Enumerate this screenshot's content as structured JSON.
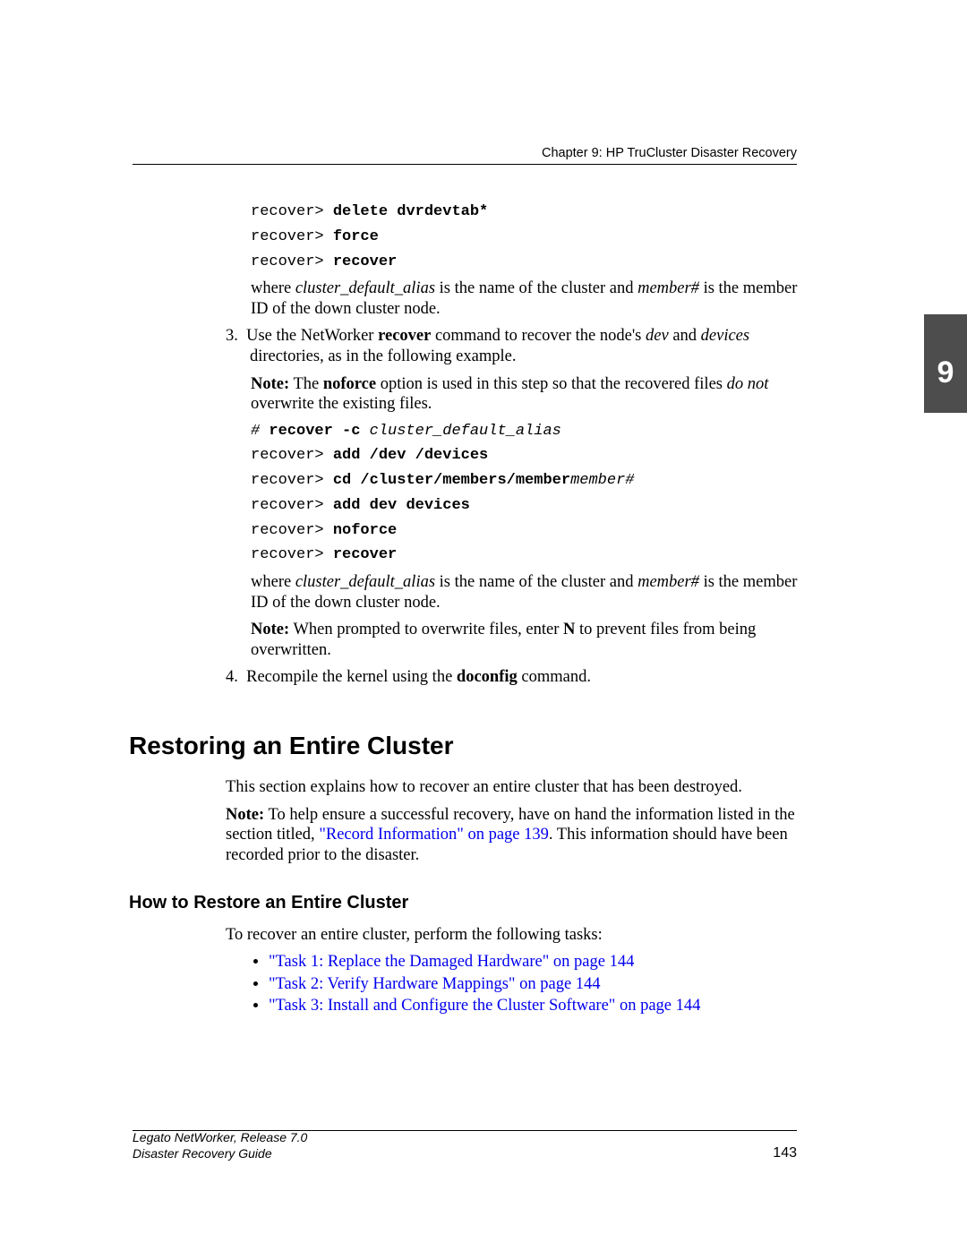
{
  "header": {
    "chapter_line": "Chapter 9: HP TruCluster Disaster Recovery"
  },
  "tab": {
    "number": "9"
  },
  "code_block_1": {
    "l1a": "recover>",
    "l1b": " delete dvrdevtab*",
    "l2a": "recover>",
    "l2b": " force",
    "l3a": "recover>",
    "l3b": " recover"
  },
  "where1": {
    "prefix": "where ",
    "cda": "cluster_default_alias",
    "mid": " is the name of the cluster and ",
    "mem": "member#",
    "suffix": " is the member ID of the down cluster node."
  },
  "step3": {
    "num": "3.",
    "t1": "Use the NetWorker ",
    "b1": "recover",
    "t2": " command to recover the node's ",
    "i1": "dev",
    "t3": " and ",
    "i2": "devices",
    "t4": " directories, as in the following example."
  },
  "note1": {
    "b1": "Note:",
    "t1": " The ",
    "b2": "noforce",
    "t2": " option is used in this step so that the recovered files ",
    "i1": "do not",
    "t3": " overwrite the existing files."
  },
  "code_block_2": {
    "l1a": "#",
    "l1b": " recover -c",
    "l1c": " cluster_default_alias",
    "l2a": "recover>",
    "l2b": " add /dev /devices",
    "l3a": "recover>",
    "l3b": " cd /cluster/members/member",
    "l3c": "member#",
    "l4a": "recover>",
    "l4b": " add dev devices",
    "l5a": "recover>",
    "l5b": " noforce",
    "l6a": "recover>",
    "l6b": " recover"
  },
  "where2": {
    "prefix": "where ",
    "cda": "cluster_default_alias",
    "mid": " is the name of the cluster and ",
    "mem": "member#",
    "suffix": " is the member ID of the down cluster node."
  },
  "note2": {
    "b1": "Note:",
    "t1": " When prompted to overwrite files, enter ",
    "b2": "N",
    "t2": " to prevent files from being overwritten."
  },
  "step4": {
    "num": "4.",
    "t1": "Recompile the kernel using the ",
    "b1": "doconfig",
    "t2": " command."
  },
  "heading1": "Restoring an Entire Cluster",
  "sec_para": "This section explains how to recover an entire cluster that has been destroyed.",
  "note3": {
    "b1": "Note:",
    "t1": " To help ensure a successful recovery, have on hand the information listed in the section titled, ",
    "link": "\"Record Information\" on page 139",
    "t2": ". This information should have been recorded prior to the disaster."
  },
  "heading2": "How to Restore an Entire Cluster",
  "tasks_intro": "To recover an entire cluster, perform the following tasks:",
  "tasks": {
    "t1": "\"Task 1: Replace the Damaged Hardware\" on page 144",
    "t2": "\"Task 2: Verify Hardware Mappings\" on page 144",
    "t3": "\"Task 3: Install and Configure the Cluster Software\" on page 144"
  },
  "footer": {
    "line1": "Legato NetWorker, Release 7.0",
    "line2": "Disaster Recovery Guide",
    "page": "143"
  }
}
